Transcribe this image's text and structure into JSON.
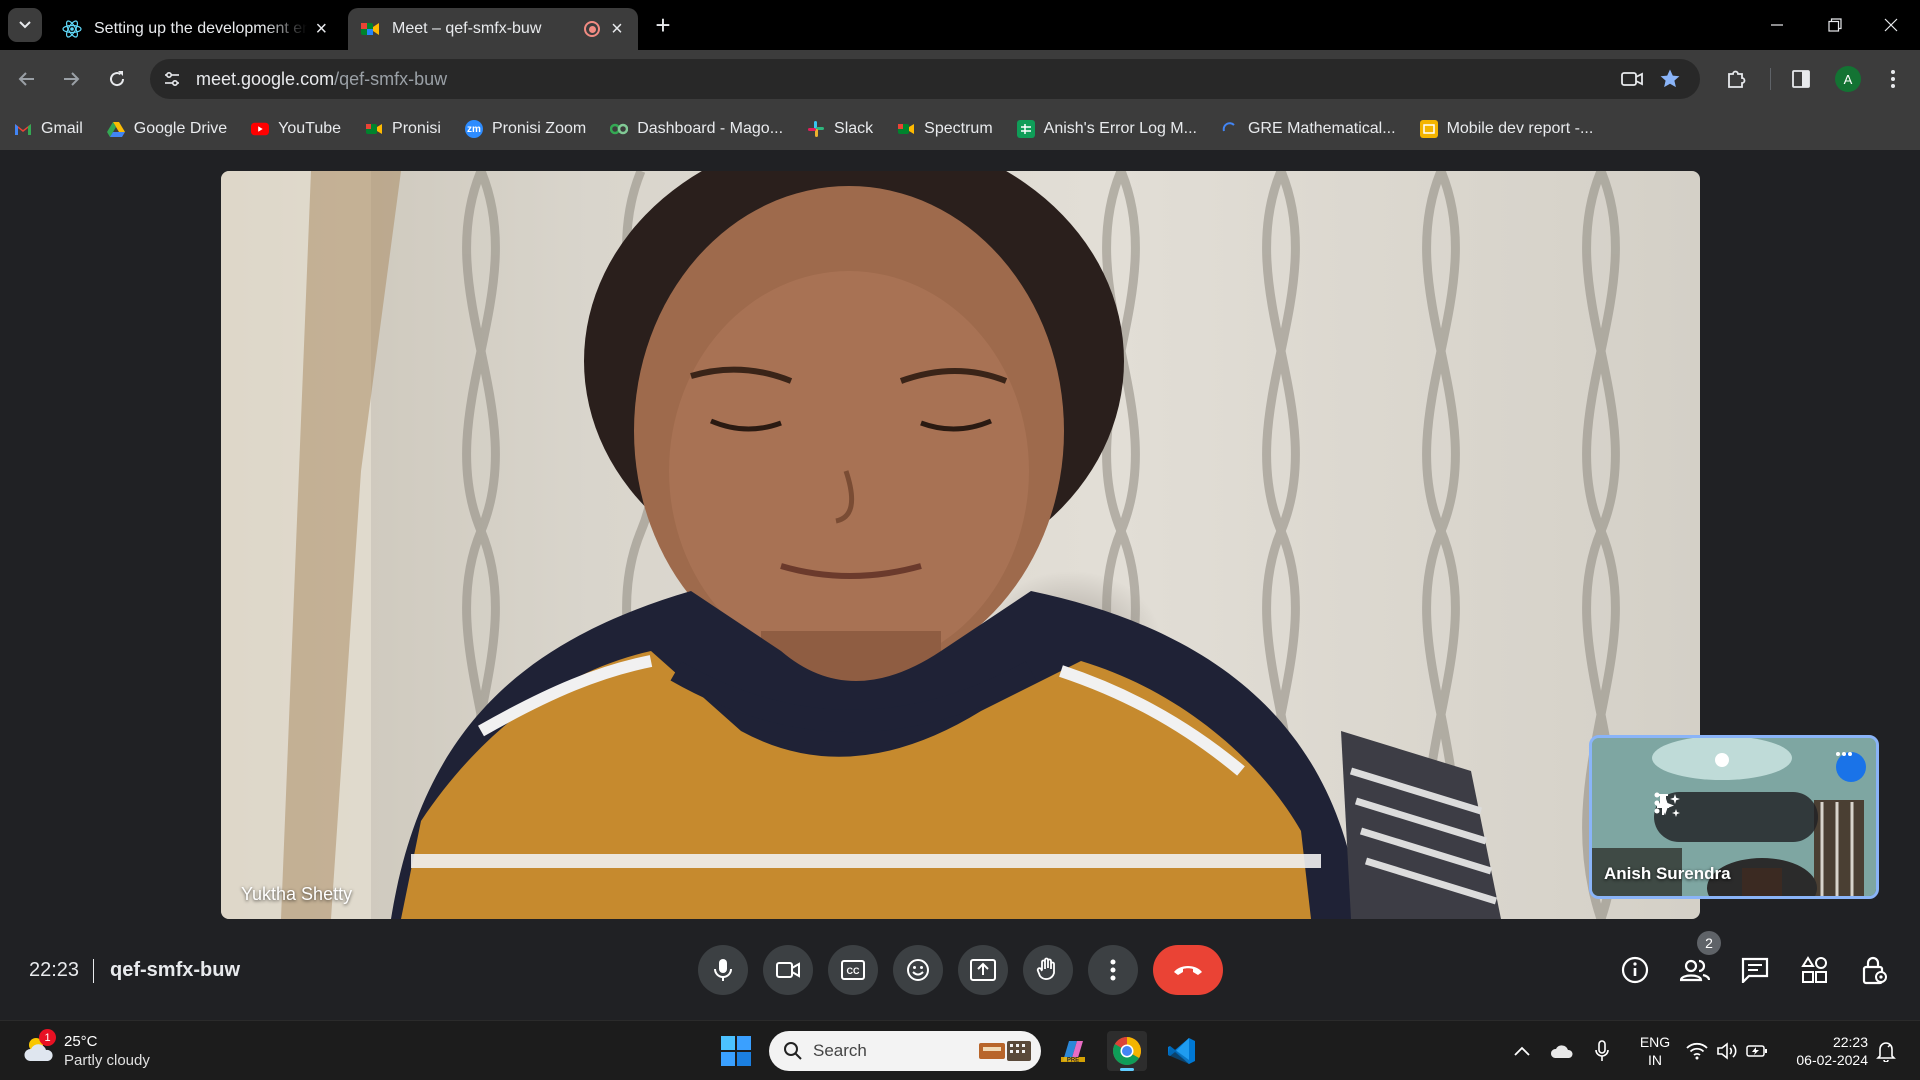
{
  "browser": {
    "tabs": [
      {
        "title": "Setting up the development environment",
        "active": false,
        "icon": "react-icon"
      },
      {
        "title": "Meet – qef-smfx-buw",
        "active": true,
        "icon": "google-meet-icon",
        "recording": true
      }
    ],
    "url": {
      "domain": "meet.google.com",
      "path": "/qef-smfx-buw"
    },
    "profile_initial": "A",
    "bookmarks": [
      {
        "label": "Gmail",
        "icon": "gmail-icon",
        "color": "#ea4335"
      },
      {
        "label": "Google Drive",
        "icon": "google-drive-icon",
        "color": "#34a853"
      },
      {
        "label": "YouTube",
        "icon": "youtube-icon",
        "color": "#ff0000"
      },
      {
        "label": "Pronisi",
        "icon": "meet-icon",
        "color": "#00897b"
      },
      {
        "label": "Pronisi Zoom",
        "icon": "zoom-icon",
        "color": "#2d8cff"
      },
      {
        "label": "Dashboard - Mago...",
        "icon": "dashboard-icon",
        "color": "#34a853"
      },
      {
        "label": "Slack",
        "icon": "slack-icon",
        "color": "#e01e5a"
      },
      {
        "label": "Spectrum",
        "icon": "meet-icon",
        "color": "#00897b"
      },
      {
        "label": "Anish's Error Log M...",
        "icon": "sheets-icon",
        "color": "#0f9d58"
      },
      {
        "label": "GRE Mathematical...",
        "icon": "loading-icon",
        "color": "#4285f4"
      },
      {
        "label": "Mobile dev report -...",
        "icon": "slides-icon",
        "color": "#f4b400"
      }
    ]
  },
  "meet": {
    "main_participant": "Yuktha Shetty",
    "self_participant": "Anish Surendra",
    "time": "22:23",
    "meeting_code": "qef-smfx-buw",
    "people_count": "2",
    "controls": [
      "mic-icon",
      "camera-icon",
      "captions-icon",
      "emoji-icon",
      "present-icon",
      "raise-hand-icon",
      "more-options-icon",
      "end-call-icon"
    ],
    "side_controls": [
      "info-icon",
      "people-icon",
      "chat-icon",
      "activities-icon",
      "host-controls-icon"
    ],
    "end_call_color": "#ea4335"
  },
  "taskbar": {
    "weather": {
      "temp": "25°C",
      "desc": "Partly cloudy",
      "badge": "1"
    },
    "search_placeholder": "Search",
    "apps": [
      "copilot-icon",
      "chrome-icon",
      "vscode-icon"
    ],
    "language": {
      "line1": "ENG",
      "line2": "IN"
    },
    "clock": {
      "time": "22:23",
      "date": "06-02-2024"
    }
  }
}
